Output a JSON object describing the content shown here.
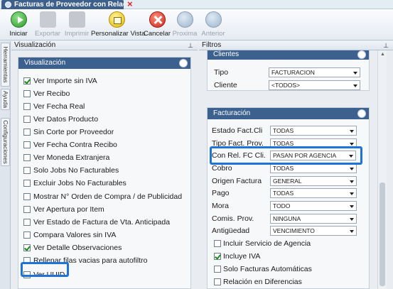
{
  "window": {
    "tab_title": "Facturas de Proveedor con Relac...",
    "close_glyph": "×"
  },
  "toolbar": {
    "buttons": [
      {
        "label": "Iniciar",
        "icon": "play-icon",
        "enabled": true
      },
      {
        "label": "Exportar",
        "icon": "export-icon",
        "enabled": false
      },
      {
        "label": "Imprimir",
        "icon": "printer-icon",
        "enabled": false
      },
      {
        "label": "Personalizar Vista",
        "icon": "customize-view-icon",
        "enabled": true
      },
      {
        "label": "Cancelar",
        "icon": "cancel-icon",
        "enabled": true
      },
      {
        "label": "Proxima",
        "icon": "next-icon",
        "enabled": false
      },
      {
        "label": "Anterior",
        "icon": "previous-icon",
        "enabled": false
      }
    ]
  },
  "side_tabs": [
    "Herramientas",
    "Ayuda",
    "Configuraciones"
  ],
  "left_panel": {
    "header": "Visualización",
    "pin_glyph": "⊥",
    "group_title": "Visualización",
    "options": [
      {
        "label": "Ver Importe sin IVA",
        "checked": true
      },
      {
        "label": "Ver Recibo",
        "checked": false
      },
      {
        "label": "Ver Fecha Real",
        "checked": false
      },
      {
        "label": "Ver Datos Producto",
        "checked": false
      },
      {
        "label": "Sin Corte por Proveedor",
        "checked": false
      },
      {
        "label": "Ver Fecha Contra Recibo",
        "checked": false
      },
      {
        "label": "Ver Moneda Extranjera",
        "checked": false
      },
      {
        "label": "Solo Jobs No Facturables",
        "checked": false
      },
      {
        "label": "Excluir Jobs No Facturables",
        "checked": false
      },
      {
        "label": "Mostrar N° Orden de Compra / de Publicidad",
        "checked": false
      },
      {
        "label": "Ver Apertura por Item",
        "checked": false
      },
      {
        "label": "Ver Estado de Factura de Vta. Anticipada",
        "checked": false
      },
      {
        "label": "Compara Valores sin IVA",
        "checked": false
      },
      {
        "label": "Ver Detalle Observaciones",
        "checked": true
      },
      {
        "label": "Rellenar filas vacias para autofiltro",
        "checked": false
      },
      {
        "label": "Ver UUID",
        "checked": false
      }
    ]
  },
  "right_panel": {
    "header": "Filtros",
    "pin_glyph": "⊥",
    "clientes": {
      "title": "Clientes",
      "fields": [
        {
          "label": "Tipo",
          "value": "FACTURACION"
        },
        {
          "label": "Cliente",
          "value": "<TODOS>"
        }
      ]
    },
    "facturacion": {
      "title": "Facturación",
      "fields": [
        {
          "label": "Estado Fact.Cli",
          "value": "TODAS"
        },
        {
          "label": "Tipo Fact. Prov.",
          "value": "TODAS"
        },
        {
          "label": "Con Rel. FC Cli.",
          "value": "PASAN POR AGENCIA"
        },
        {
          "label": "Cobro",
          "value": "TODAS"
        },
        {
          "label": "Origen Factura",
          "value": "GENERAL"
        },
        {
          "label": "Pago",
          "value": "TODAS"
        },
        {
          "label": "Mora",
          "value": "TODO"
        },
        {
          "label": "Comis. Prov.",
          "value": "NINGUNA"
        },
        {
          "label": "Antigüedad",
          "value": "VENCIMIENTO"
        }
      ],
      "checkboxes": [
        {
          "label": "Incluir Servicio de Agencia",
          "checked": false
        },
        {
          "label": "Incluye IVA",
          "checked": true
        },
        {
          "label": "Solo Facturas Automáticas",
          "checked": false
        },
        {
          "label": "Relación en Diferencias",
          "checked": false
        }
      ]
    }
  },
  "colors": {
    "accent": "#3d618f",
    "highlight": "#1e73d8",
    "check": "#1c8a1c"
  }
}
